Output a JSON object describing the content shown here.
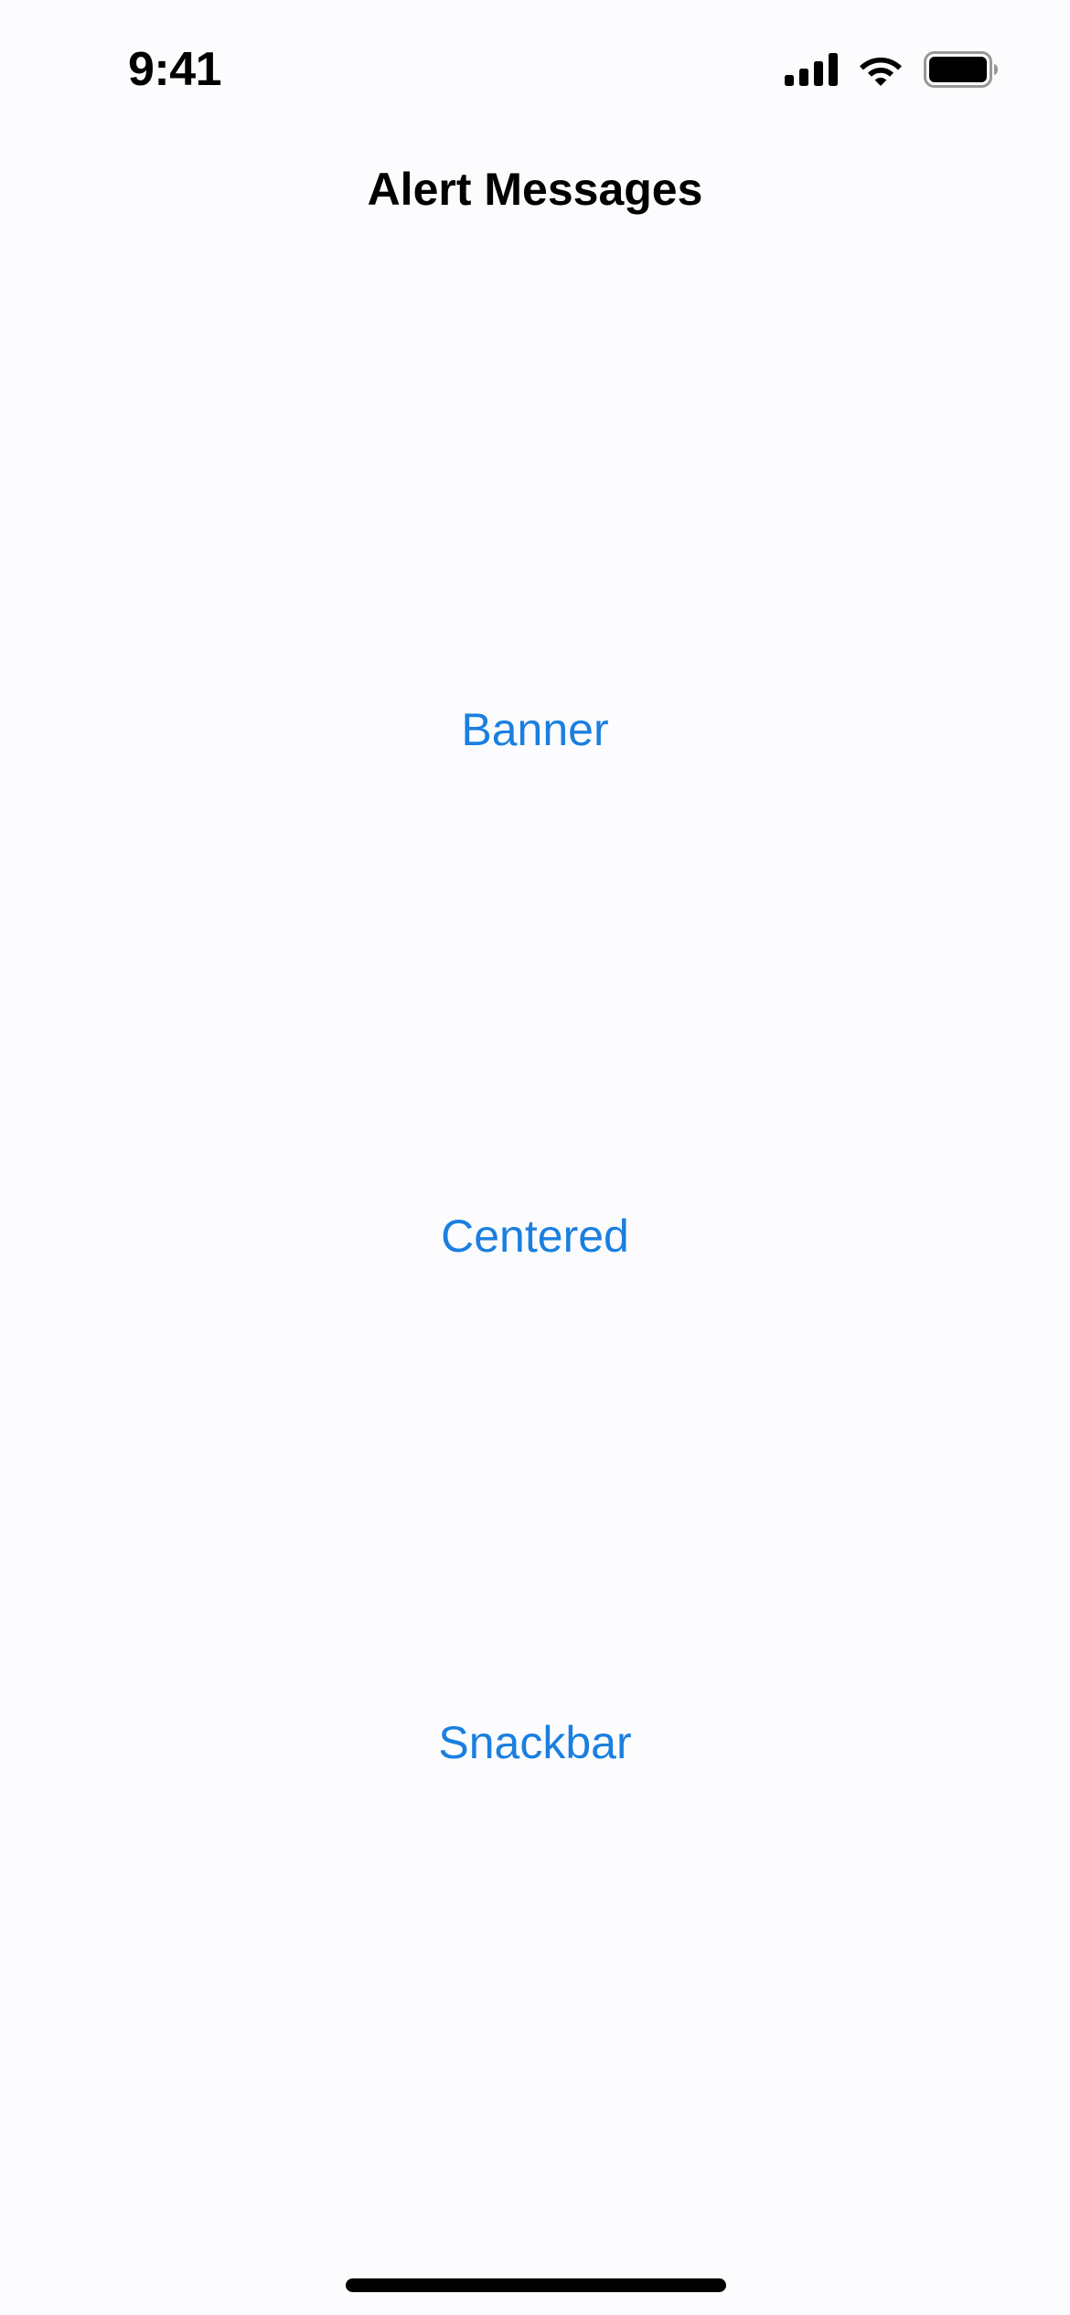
{
  "status_bar": {
    "time": "9:41",
    "icons": [
      "cellular-signal-icon",
      "wifi-icon",
      "battery-icon"
    ]
  },
  "nav": {
    "title": "Alert Messages"
  },
  "buttons": [
    {
      "label": "Banner"
    },
    {
      "label": "Centered"
    },
    {
      "label": "Snackbar"
    }
  ],
  "colors": {
    "background": "#FCFCFE",
    "accent": "#1A7FE0",
    "text": "#000000"
  }
}
